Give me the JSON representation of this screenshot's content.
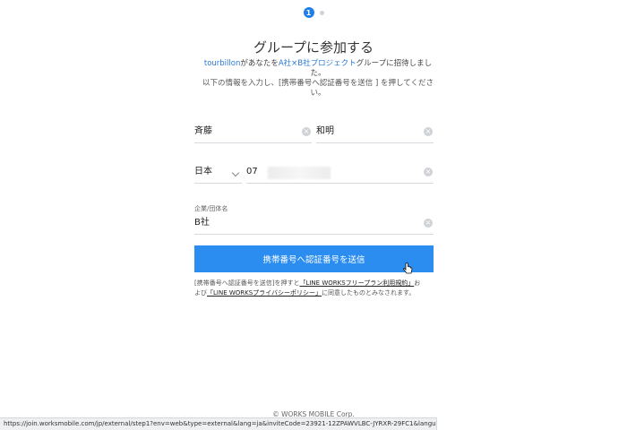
{
  "stepper": {
    "current": "1",
    "total_steps": 2
  },
  "title": "グループに参加する",
  "invite": {
    "inviter": "tourbillon",
    "text_mid": "があなたを",
    "group": "A社×B社プロジェクト",
    "text_end_line1": "グループに招待しまし",
    "text_end_line2": "た。"
  },
  "instruction": {
    "line1": "以下の情報を入力し、[携帯番号へ認証番号を送信 ] を押してくださ",
    "line2": "い。"
  },
  "form": {
    "last_name": "斉藤",
    "first_name": "和明",
    "country": "日本",
    "phone_visible": "07",
    "company_label": "企業/団体名",
    "company": "B社"
  },
  "send_button": "携帯番号へ認証番号を送信",
  "terms": {
    "line1_pre": "[携帯番号へ認証番号を送信]を押すと",
    "link1": "「LINE WORKSフリープラン利用規約」",
    "line1_post": "お",
    "line2_pre": "よび",
    "link2": "「LINE WORKSプライバシーポリシー」",
    "line2_post": "に同意したものとみなされます。"
  },
  "footer": "© WORKS MOBILE Corp.",
  "status_url": "https://join.worksmobile.com/jp/external/step1?env=web&type=external&lang=ja&inviteCode=23921-12ZPAWVLBC-JYRXR-29FC1&language=ja_JP",
  "colors": {
    "accent": "#2b8df0",
    "link": "#2a79d6"
  }
}
